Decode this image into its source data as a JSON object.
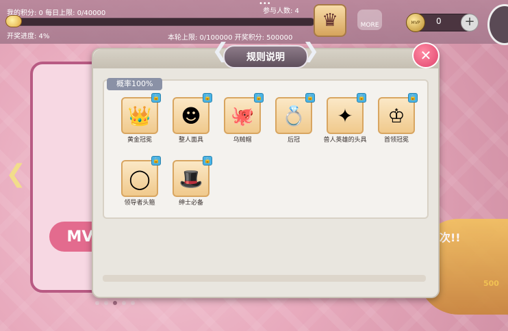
{
  "hud": {
    "my_points": "我的积分:  0 每日上限: 0/40000",
    "participants": "参与人数: 4",
    "draw_progress": "开奖进度:  4%",
    "round_info": "本轮上限:  0/100000 开奖积分:     500000",
    "draw_progress_fraction": 0.04,
    "more_label": "MORE",
    "currency_value": "0",
    "coin_label": "MVP",
    "right_deco_text": "十次!!",
    "right_deco_amount": "500",
    "left_card_badge": "MV"
  },
  "dialog": {
    "title": "规则说明",
    "probability_tag": "概率100%",
    "items": [
      {
        "name": "黄金冠冕",
        "icon": "crown-icon"
      },
      {
        "name": "整人面具",
        "icon": "mask-icon"
      },
      {
        "name": "乌贼帽",
        "icon": "squid-hat-icon"
      },
      {
        "name": "后冠",
        "icon": "tiara-icon"
      },
      {
        "name": "兽人英雄的头具",
        "icon": "orc-helmet-icon"
      },
      {
        "name": "首领冠冕",
        "icon": "boss-crown-icon"
      },
      {
        "name": "领导者头箍",
        "icon": "headband-icon"
      },
      {
        "name": "绅士必备",
        "icon": "top-hat-icon"
      }
    ]
  },
  "colors": {
    "accent": "#e0446d",
    "title_badge": "#6f5e6c",
    "lock_badge": "#49b4e6",
    "item_frame": "#d8a560"
  }
}
